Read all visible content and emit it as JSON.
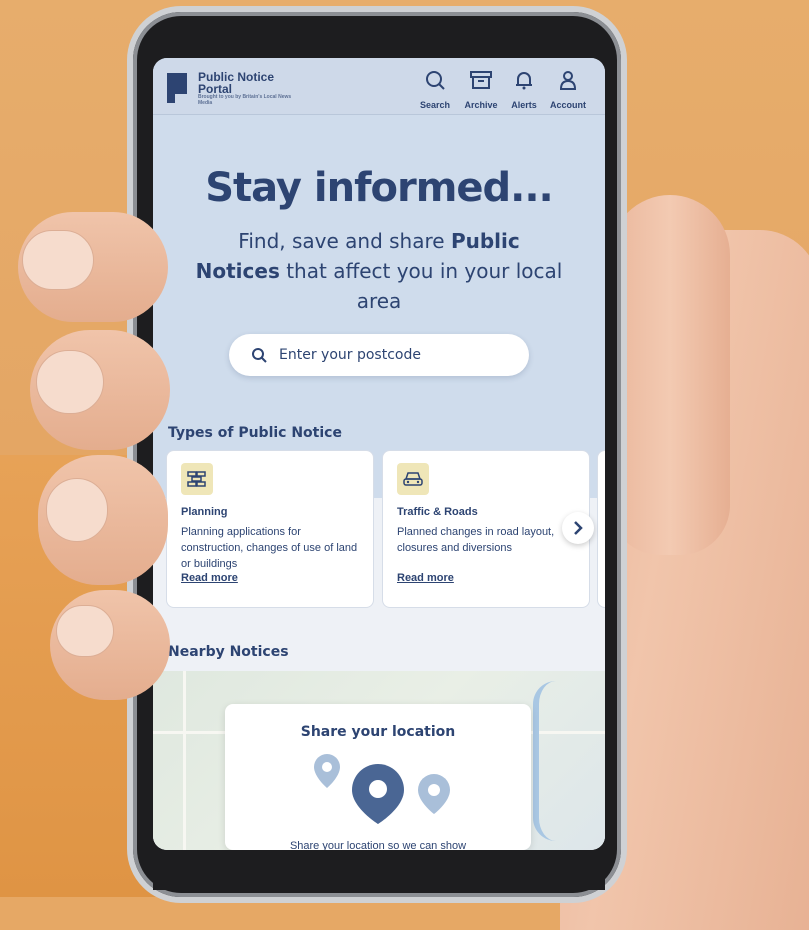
{
  "header": {
    "logo_line1": "Public Notice",
    "logo_line2": "Portal",
    "logo_tagline": "Brought to you by Britain's Local News Media",
    "nav": [
      {
        "label": "Search",
        "icon": "search-icon"
      },
      {
        "label": "Archive",
        "icon": "archive-icon"
      },
      {
        "label": "Alerts",
        "icon": "bell-icon"
      },
      {
        "label": "Account",
        "icon": "user-icon"
      }
    ]
  },
  "hero": {
    "title": "Stay informed...",
    "sub_before": "Find, save and share ",
    "sub_bold": "Public Notices",
    "sub_after": " that affect you in your local area"
  },
  "search": {
    "placeholder": "Enter your postcode"
  },
  "types": {
    "heading": "Types of Public Notice",
    "cards": [
      {
        "title": "Planning",
        "desc": "Planning applications for construction, changes of use of land or buildings",
        "link": "Read more",
        "icon": "bricks-icon"
      },
      {
        "title": "Traffic & Roads",
        "desc": "Planned changes in road layout, closures and diversions",
        "link": "Read more",
        "icon": "car-icon"
      }
    ]
  },
  "nearby": {
    "heading": "Nearby Notices",
    "share_title": "Share your location",
    "share_desc": "Share your location so we can show"
  },
  "colors": {
    "brand": "#2d4472",
    "hero_bg": "#cfdcec",
    "icon_bg": "#efe6b8",
    "background_orange": "#e6a865"
  }
}
